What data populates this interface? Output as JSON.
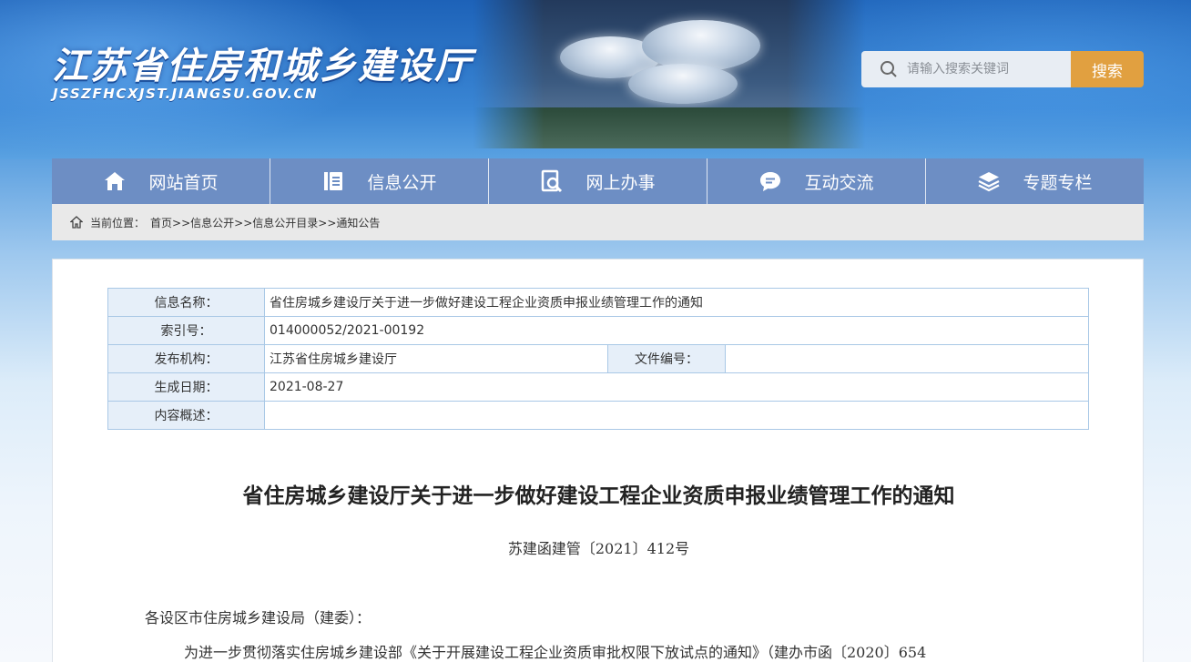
{
  "header": {
    "site_title": "江苏省住房和城乡建设厅",
    "site_domain": "JSSZFHCXJST.JIANGSU.GOV.CN"
  },
  "search": {
    "placeholder": "请输入搜索关键词",
    "button_label": "搜索"
  },
  "nav": {
    "items": [
      {
        "label": "网站首页",
        "icon": "home-icon"
      },
      {
        "label": "信息公开",
        "icon": "document-icon"
      },
      {
        "label": "网上办事",
        "icon": "search-doc-icon"
      },
      {
        "label": "互动交流",
        "icon": "chat-icon"
      },
      {
        "label": "专题专栏",
        "icon": "layers-icon"
      }
    ]
  },
  "breadcrumb": {
    "prefix": "当前位置：",
    "items": [
      "首页",
      ">>信息公开",
      ">>信息公开目录",
      ">>通知公告"
    ],
    "separator": ">"
  },
  "meta": {
    "name_label": "信息名称：",
    "name_value": "省住房城乡建设厅关于进一步做好建设工程企业资质申报业绩管理工作的通知",
    "index_label": "索引号：",
    "index_value": "014000052/2021-00192",
    "publisher_label": "发布机构：",
    "publisher_value": "江苏省住房城乡建设厅",
    "docno_label": "文件编号：",
    "docno_value": "",
    "date_label": "生成日期：",
    "date_value": "2021-08-27",
    "summary_label": "内容概述：",
    "summary_value": ""
  },
  "article": {
    "title": "省住房城乡建设厅关于进一步做好建设工程企业资质申报业绩管理工作的通知",
    "doc_number": "苏建函建管〔2021〕412号",
    "salutation": "各设区市住房城乡建设局（建委）：",
    "body_start": "为进一步贯彻落实住房城乡建设部《关于开展建设工程企业资质审批权限下放试点的通知》（建办市函〔2020〕654"
  },
  "colors": {
    "nav_bg": "#6d8ec4",
    "search_button": "#e1a040",
    "table_border": "#a9c8e6",
    "label_bg": "#e6eff9"
  }
}
